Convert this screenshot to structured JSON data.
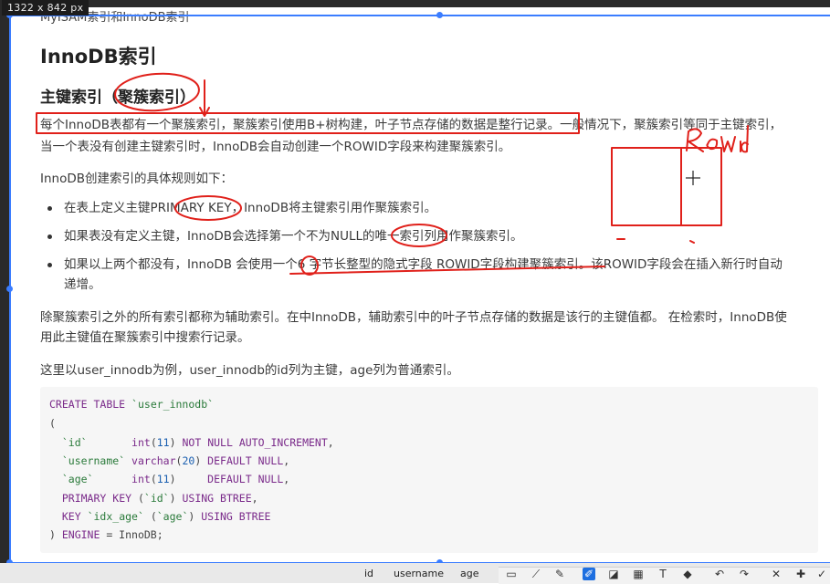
{
  "overlay": {
    "size_badge": "1322 x 842  px"
  },
  "doc": {
    "cut_title": "MyISAM索引和InnoDB索引",
    "h1": "InnoDB索引",
    "h2": "主键索引（聚簇索引）",
    "p1_line1": "每个InnoDB表都有一个聚簇索引，聚簇索引使用B+树构建，叶子节点存储的数据是整行记录。一般情况下，聚簇索引等同于主键索引，",
    "p1_line2": "当一个表没有创建主键索引时，InnoDB会自动创建一个ROWID字段来构建聚簇索引。",
    "p2": "InnoDB创建索引的具体规则如下：",
    "bullets": [
      "在表上定义主键PRIMARY KEY，InnoDB将主键索引用作聚簇索引。",
      "如果表没有定义主键，InnoDB会选择第一个不为NULL的唯一索引列用作聚簇索引。",
      "如果以上两个都没有，InnoDB 会使用一个6 字节长整型的隐式字段 ROWID字段构建聚簇索引。该ROWID字段会在插入新行时自动",
      "递增。"
    ],
    "p3_line1": "除聚簇索引之外的所有索引都称为辅助索引。在中InnoDB，辅助索引中的叶子节点存储的数据是该行的主键值都。 在检索时，InnoDB使",
    "p3_line2": "用此主键值在聚簇索引中搜索行记录。",
    "p4": "这里以user_innodb为例，user_innodb的id列为主键，age列为普通索引。",
    "code": [
      "CREATE TABLE `user_innodb`",
      "(",
      "  `id`       int(11) NOT NULL AUTO_INCREMENT,",
      "  `username` varchar(20) DEFAULT NULL,",
      "  `age`      int(11)     DEFAULT NULL,",
      "  PRIMARY KEY (`id`) USING BTREE,",
      "  KEY `idx_age` (`age`) USING BTREE",
      ") ENGINE = InnoDB;"
    ]
  },
  "annotation": {
    "handwriting": "ROWid"
  },
  "bottom": {
    "columns": [
      "id",
      "username",
      "age"
    ]
  },
  "toolbar": {
    "icons": [
      "crop-icon",
      "line-icon",
      "pen-icon",
      "marker-icon",
      "highlighter-icon",
      "mosaic-icon",
      "text-icon",
      "eraser-icon",
      "undo-icon",
      "redo-icon",
      "close-icon",
      "pin-icon",
      "check-icon"
    ],
    "accent": "#1e6fe0"
  },
  "colors": {
    "annotation_red": "#e0201a",
    "selection_blue": "#3b7dff"
  }
}
